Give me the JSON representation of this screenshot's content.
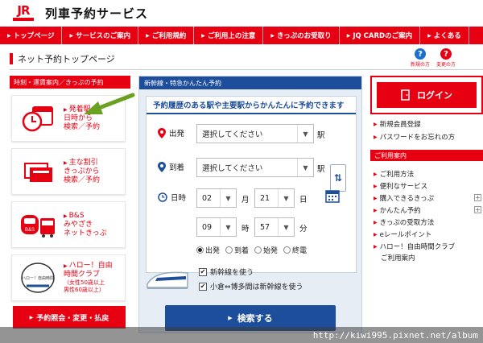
{
  "header": {
    "logo_text": "JR",
    "site_title": "列車予約サービス"
  },
  "nav": [
    "トップページ",
    "サービスのご案内",
    "ご利用規約",
    "ご利用上の注意",
    "きっぷのお受取り",
    "JQ CARDのご案内",
    "よくある"
  ],
  "page": {
    "title": "ネット予約トップページ"
  },
  "help": {
    "new_label": "新規の方",
    "change_label": "変更の方"
  },
  "left": {
    "heading": "時刻・運賃案内／きっぷの予約",
    "cards": [
      {
        "lines": [
          "発着駅・",
          "日時から",
          "検索／予約"
        ]
      },
      {
        "lines": [
          "主な割引",
          "きっぷから",
          "検索／予約"
        ]
      },
      {
        "art_text": "B&S",
        "lines": [
          "B&S",
          "みやざき",
          "ネットきっぷ"
        ]
      },
      {
        "art_text": "ハロー！自由時間",
        "lines": [
          "ハロー！自由",
          "時間クラブ"
        ],
        "small": [
          "（女性50歳以上",
          "男性60歳以上）"
        ]
      }
    ],
    "inquiry": "予約照会・変更・払戻"
  },
  "middle": {
    "heading": "新幹線・特急かんたん予約",
    "title": "予約履歴のある駅や主要駅からかんたんに予約できます",
    "depart_label": "出発",
    "arrive_label": "到着",
    "date_label": "日時",
    "station_placeholder": "選択してください",
    "station_unit": "駅",
    "month": "02",
    "month_unit": "月",
    "day": "21",
    "day_unit": "日",
    "hour": "09",
    "hour_unit": "時",
    "minute": "57",
    "minute_unit": "分",
    "radios": [
      "出発",
      "到着",
      "始発",
      "終電"
    ],
    "selected_radio": 0,
    "option1": "新幹線を使う",
    "option2": "小倉⇔博多間は新幹線を使う",
    "search": "検索する"
  },
  "right": {
    "login": "ログイン",
    "links_top": [
      "新規会員登録",
      "パスワードをお忘れの方"
    ],
    "heading": "ご利用案内",
    "links": [
      "ご利用方法",
      "便利なサービス",
      "購入できるきっぷ",
      "かんたん予約",
      "きっぷの受取方法",
      "eレールポイント",
      "ハロー！自由時間クラブ",
      "ご利用案内"
    ]
  },
  "watermark": "http://kiwi995.pixnet.net/album",
  "colors": {
    "brand_red": "#e60012",
    "brand_blue": "#1d4e9b",
    "help_blue": "#1d6fcf",
    "arrow_green": "#6aa121"
  }
}
